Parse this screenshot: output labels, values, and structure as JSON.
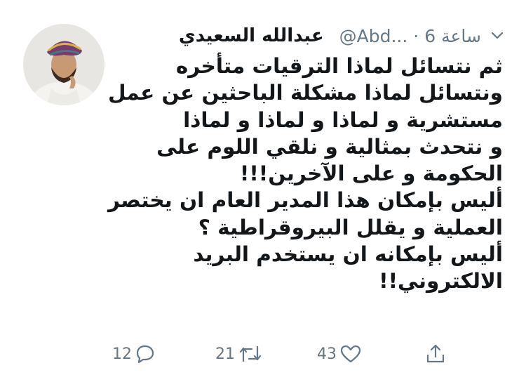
{
  "tweet": {
    "author_name": "عبدالله السعيدي",
    "handle": "@Abd...",
    "separator": "·",
    "time": "6 ساعة",
    "lines": [
      "ثم نتسائل لماذا الترقيات متأخره",
      "ونتسائل لماذا مشكلة الباحثين عن عمل",
      "مستشرية و لماذا و لماذا و لماذا",
      "و نتحدث بمثالية و نلقي اللوم على",
      "الحكومة و على الآخرين!!!",
      "أليس بإمكان هذا المدير العام ان يختصر",
      "العملية و يقلل البيروقراطية ؟",
      "أليس بإمكانه ان يستخدم البريد",
      "الالكتروني!!"
    ]
  },
  "actions": {
    "replies": "12",
    "retweets": "21",
    "likes": "43"
  },
  "icons": {
    "chevron": "chevron-down-icon",
    "reply": "reply-icon",
    "retweet": "retweet-icon",
    "like": "heart-icon",
    "share": "share-icon"
  },
  "colors": {
    "text": "#14171a",
    "secondary": "#657786"
  }
}
